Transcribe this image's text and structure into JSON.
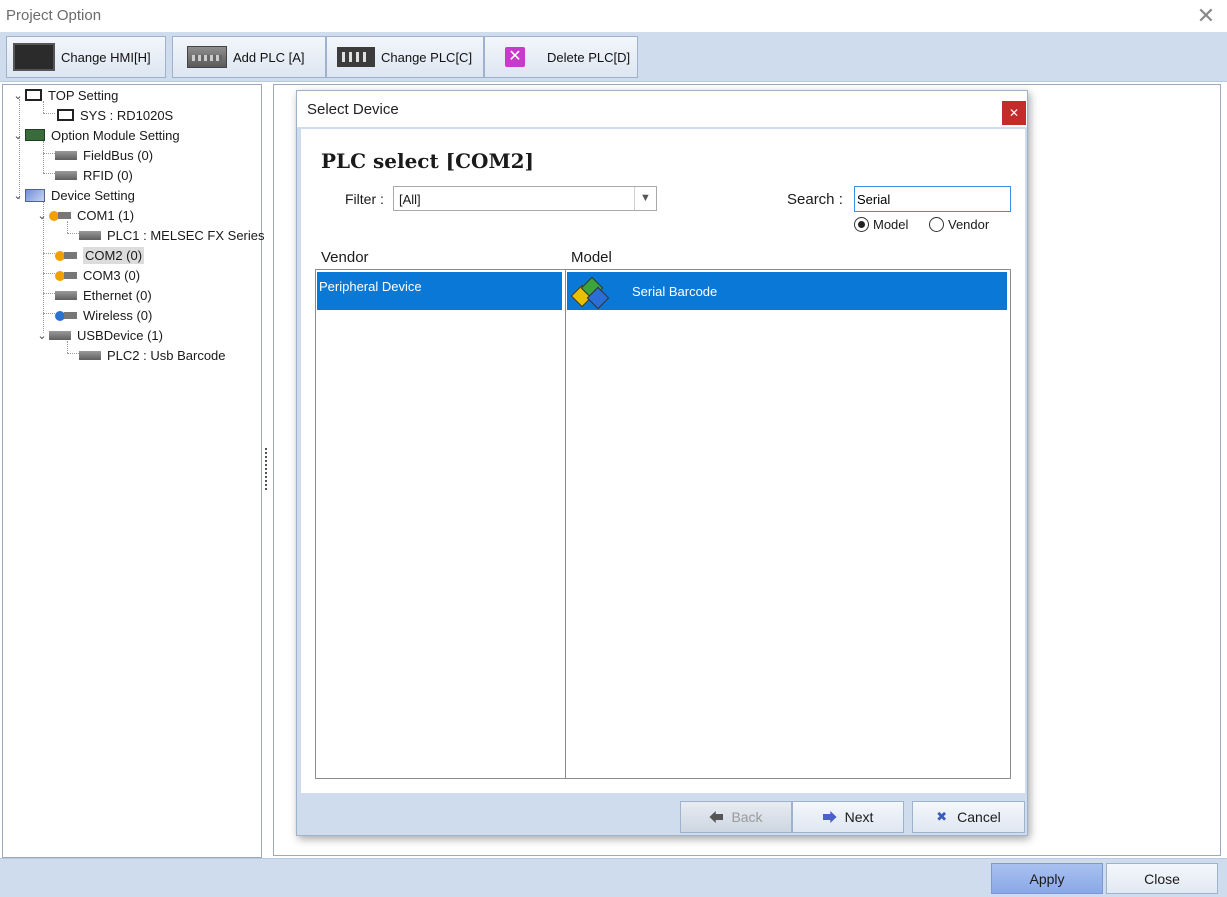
{
  "window": {
    "title": "Project Option"
  },
  "toolbar": {
    "change_hmi": "Change HMI[H]",
    "add_plc": "Add PLC [A]",
    "change_plc": "Change PLC[C]",
    "delete_plc": "Delete PLC[D]"
  },
  "tree": {
    "top_setting": "TOP Setting",
    "sys": "SYS : RD1020S",
    "option_module": "Option Module Setting",
    "fieldbus": "FieldBus (0)",
    "rfid": "RFID (0)",
    "device_setting": "Device Setting",
    "com1": "COM1 (1)",
    "plc1": "PLC1 : MELSEC FX Series",
    "com2": "COM2 (0)",
    "com3": "COM3 (0)",
    "ethernet": "Ethernet (0)",
    "wireless": "Wireless (0)",
    "usbdevice": "USBDevice (1)",
    "plc2": "PLC2 : Usb Barcode"
  },
  "dialog": {
    "title": "Select Device",
    "heading": "PLC select [COM2]",
    "filter_label": "Filter :",
    "filter_value": "[All]",
    "search_label": "Search :",
    "search_value": "Serial",
    "radio_model": "Model",
    "radio_vendor": "Vendor",
    "radio_selected": "Model",
    "vendor_header": "Vendor",
    "model_header": "Model",
    "vendors": [
      "Peripheral Device"
    ],
    "models": [
      "Serial Barcode"
    ],
    "back": "Back",
    "next": "Next",
    "cancel": "Cancel"
  },
  "footer": {
    "apply": "Apply",
    "close": "Close"
  },
  "colors": {
    "selection": "#0a78d7",
    "chrome": "#cfdcee",
    "close_red": "#c42b2b"
  },
  "icons": {
    "toolbar": [
      "hmi-icon",
      "plc-icon",
      "change-plc-icon",
      "delete-icon"
    ],
    "dialog_close": "close-icon",
    "model": "cubes-icon"
  }
}
